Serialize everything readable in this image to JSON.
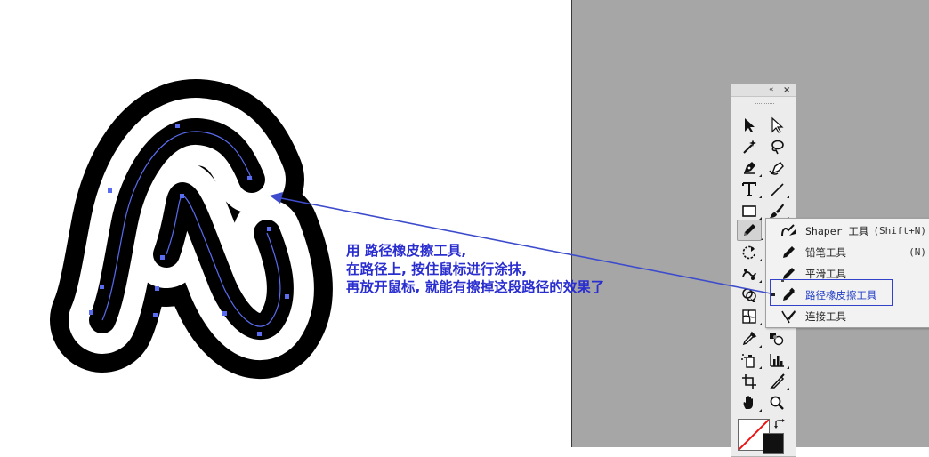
{
  "annotation": {
    "line1": "用 路径橡皮擦工具,",
    "line2": "在路径上, 按住鼠标进行涂抹,",
    "line3": "再放开鼠标, 就能有擦掉这段路径的效果了"
  },
  "colors": {
    "annotation_text": "#2b2ecf",
    "path_line": "#5a6cf0",
    "highlight_box": "#3343c9",
    "artwork_fill": "#000000",
    "workspace_bg": "#a6a6a6",
    "panel_bg": "#ececec"
  },
  "toolbar": {
    "collapse_glyph": "«",
    "close_glyph": "×",
    "tools": [
      {
        "name": "selection-tool",
        "icon": "selection-arrow-icon"
      },
      {
        "name": "direct-selection-tool",
        "icon": "direct-selection-arrow-icon"
      },
      {
        "name": "magic-wand-tool",
        "icon": "magic-wand-icon"
      },
      {
        "name": "lasso-tool",
        "icon": "lasso-icon"
      },
      {
        "name": "pen-tool",
        "icon": "pen-nib-icon"
      },
      {
        "name": "curvature-tool",
        "icon": "curvature-pen-icon"
      },
      {
        "name": "type-tool",
        "icon": "type-t-icon",
        "glyph": "T"
      },
      {
        "name": "line-segment-tool",
        "icon": "line-segment-icon"
      },
      {
        "name": "rectangle-tool",
        "icon": "rectangle-icon"
      },
      {
        "name": "paintbrush-tool",
        "icon": "paintbrush-icon"
      },
      {
        "name": "pencil-tool",
        "icon": "pencil-icon",
        "selected": true
      },
      {
        "name": "rotate-tool",
        "icon": "rotate-icon"
      },
      {
        "name": "puppet-warp-tool",
        "icon": "puppet-warp-icon"
      },
      {
        "name": "shape-builder-tool",
        "icon": "shape-builder-icon"
      },
      {
        "name": "gradient-mesh-tool",
        "icon": "mesh-grid-icon"
      },
      {
        "name": "eyedropper-tool",
        "icon": "eyedropper-icon"
      },
      {
        "name": "blend-tool",
        "icon": "blend-icon"
      },
      {
        "name": "symbol-sprayer-tool",
        "icon": "symbol-sprayer-icon"
      },
      {
        "name": "column-graph-tool",
        "icon": "bar-graph-icon"
      },
      {
        "name": "artboard-tool",
        "icon": "artboard-icon"
      },
      {
        "name": "slice-tool",
        "icon": "slice-knife-icon"
      },
      {
        "name": "hand-tool",
        "icon": "hand-icon"
      },
      {
        "name": "zoom-tool",
        "icon": "zoom-magnifier-icon"
      }
    ]
  },
  "flyout": {
    "items": [
      {
        "label": "Shaper 工具",
        "shortcut": "(Shift+N)",
        "icon": "shaper-icon"
      },
      {
        "label": "铅笔工具",
        "shortcut": "(N)",
        "icon": "pencil-icon"
      },
      {
        "label": "平滑工具",
        "shortcut": "",
        "icon": "smooth-icon"
      },
      {
        "label": "路径橡皮擦工具",
        "shortcut": "",
        "icon": "path-eraser-icon",
        "current": true
      },
      {
        "label": "连接工具",
        "shortcut": "",
        "icon": "join-icon"
      }
    ]
  }
}
